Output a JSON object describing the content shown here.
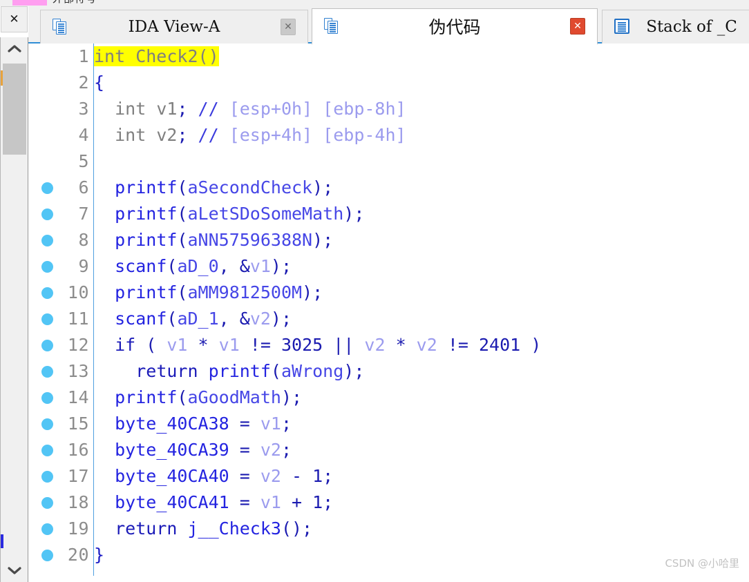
{
  "toolbar": {
    "swatch_color": "#ff9ef0",
    "partial_text": "外部符号"
  },
  "left_rail": {
    "close_label": "✕",
    "scroll_up_glyph": "⌃",
    "scroll_down_glyph": "⌄"
  },
  "tabs": [
    {
      "label": "IDA View-A",
      "icon": "document-pair-icon",
      "close_label": "✕",
      "active": false
    },
    {
      "label": "伪代码",
      "icon": "document-pair-icon",
      "close_label": "✕",
      "active": true
    },
    {
      "label": "Stack of _C",
      "icon": "stack-window-icon",
      "close_label": "",
      "active": false
    }
  ],
  "code": {
    "function_name": "Check2",
    "highlight_color": "#ffff00",
    "lines": [
      {
        "n": "1",
        "bp": false,
        "highlight": true,
        "tokens": [
          {
            "t": "int Check2()",
            "c": "t-hl"
          }
        ]
      },
      {
        "n": "2",
        "bp": false,
        "highlight": false,
        "tokens": [
          {
            "t": "{",
            "c": "t-brace"
          }
        ]
      },
      {
        "n": "3",
        "bp": false,
        "highlight": false,
        "tokens": [
          {
            "t": "  ",
            "c": "t-plain"
          },
          {
            "t": "int",
            "c": "t-kw"
          },
          {
            "t": " v1",
            "c": "t-kw"
          },
          {
            "t": ";",
            "c": "t-op"
          },
          {
            "t": " ",
            "c": "t-plain"
          },
          {
            "t": "//",
            "c": "t-cmt"
          },
          {
            "t": " [esp+0h] [ebp-8h]",
            "c": "t-cmt2"
          }
        ]
      },
      {
        "n": "4",
        "bp": false,
        "highlight": false,
        "tokens": [
          {
            "t": "  ",
            "c": "t-plain"
          },
          {
            "t": "int",
            "c": "t-kw"
          },
          {
            "t": " v2",
            "c": "t-kw"
          },
          {
            "t": ";",
            "c": "t-op"
          },
          {
            "t": " ",
            "c": "t-plain"
          },
          {
            "t": "//",
            "c": "t-cmt"
          },
          {
            "t": " [esp+4h] [ebp-4h]",
            "c": "t-cmt2"
          }
        ]
      },
      {
        "n": "5",
        "bp": false,
        "highlight": false,
        "tokens": []
      },
      {
        "n": "6",
        "bp": true,
        "highlight": false,
        "tokens": [
          {
            "t": "  ",
            "c": "t-plain"
          },
          {
            "t": "printf",
            "c": "t-fn"
          },
          {
            "t": "(",
            "c": "t-op"
          },
          {
            "t": "aSecondCheck",
            "c": "t-arg"
          },
          {
            "t": ");",
            "c": "t-op"
          }
        ]
      },
      {
        "n": "7",
        "bp": true,
        "highlight": false,
        "tokens": [
          {
            "t": "  ",
            "c": "t-plain"
          },
          {
            "t": "printf",
            "c": "t-fn"
          },
          {
            "t": "(",
            "c": "t-op"
          },
          {
            "t": "aLetSDoSomeMath",
            "c": "t-arg"
          },
          {
            "t": ");",
            "c": "t-op"
          }
        ]
      },
      {
        "n": "8",
        "bp": true,
        "highlight": false,
        "tokens": [
          {
            "t": "  ",
            "c": "t-plain"
          },
          {
            "t": "printf",
            "c": "t-fn"
          },
          {
            "t": "(",
            "c": "t-op"
          },
          {
            "t": "aNN57596388N",
            "c": "t-arg"
          },
          {
            "t": ");",
            "c": "t-op"
          }
        ]
      },
      {
        "n": "9",
        "bp": true,
        "highlight": false,
        "tokens": [
          {
            "t": "  ",
            "c": "t-plain"
          },
          {
            "t": "scanf",
            "c": "t-fn"
          },
          {
            "t": "(",
            "c": "t-op"
          },
          {
            "t": "aD_0",
            "c": "t-arg"
          },
          {
            "t": ", &",
            "c": "t-op"
          },
          {
            "t": "v1",
            "c": "t-var"
          },
          {
            "t": ");",
            "c": "t-op"
          }
        ]
      },
      {
        "n": "10",
        "bp": true,
        "highlight": false,
        "tokens": [
          {
            "t": "  ",
            "c": "t-plain"
          },
          {
            "t": "printf",
            "c": "t-fn"
          },
          {
            "t": "(",
            "c": "t-op"
          },
          {
            "t": "aMM9812500M",
            "c": "t-arg"
          },
          {
            "t": ");",
            "c": "t-op"
          }
        ]
      },
      {
        "n": "11",
        "bp": true,
        "highlight": false,
        "tokens": [
          {
            "t": "  ",
            "c": "t-plain"
          },
          {
            "t": "scanf",
            "c": "t-fn"
          },
          {
            "t": "(",
            "c": "t-op"
          },
          {
            "t": "aD_1",
            "c": "t-arg"
          },
          {
            "t": ", &",
            "c": "t-op"
          },
          {
            "t": "v2",
            "c": "t-var"
          },
          {
            "t": ");",
            "c": "t-op"
          }
        ]
      },
      {
        "n": "12",
        "bp": true,
        "highlight": false,
        "tokens": [
          {
            "t": "  ",
            "c": "t-plain"
          },
          {
            "t": "if",
            "c": "t-ctrl"
          },
          {
            "t": " ( ",
            "c": "t-op"
          },
          {
            "t": "v1",
            "c": "t-var"
          },
          {
            "t": " * ",
            "c": "t-op"
          },
          {
            "t": "v1",
            "c": "t-var"
          },
          {
            "t": " != ",
            "c": "t-op"
          },
          {
            "t": "3025",
            "c": "t-num"
          },
          {
            "t": " || ",
            "c": "t-op"
          },
          {
            "t": "v2",
            "c": "t-var"
          },
          {
            "t": " * ",
            "c": "t-op"
          },
          {
            "t": "v2",
            "c": "t-var"
          },
          {
            "t": " != ",
            "c": "t-op"
          },
          {
            "t": "2401",
            "c": "t-num"
          },
          {
            "t": " )",
            "c": "t-op"
          }
        ]
      },
      {
        "n": "13",
        "bp": true,
        "highlight": false,
        "tokens": [
          {
            "t": "    ",
            "c": "t-plain"
          },
          {
            "t": "return",
            "c": "t-ctrl"
          },
          {
            "t": " ",
            "c": "t-plain"
          },
          {
            "t": "printf",
            "c": "t-fn"
          },
          {
            "t": "(",
            "c": "t-op"
          },
          {
            "t": "aWrong",
            "c": "t-arg"
          },
          {
            "t": ");",
            "c": "t-op"
          }
        ]
      },
      {
        "n": "14",
        "bp": true,
        "highlight": false,
        "tokens": [
          {
            "t": "  ",
            "c": "t-plain"
          },
          {
            "t": "printf",
            "c": "t-fn"
          },
          {
            "t": "(",
            "c": "t-op"
          },
          {
            "t": "aGoodMath",
            "c": "t-arg"
          },
          {
            "t": ");",
            "c": "t-op"
          }
        ]
      },
      {
        "n": "15",
        "bp": true,
        "highlight": false,
        "tokens": [
          {
            "t": "  ",
            "c": "t-plain"
          },
          {
            "t": "byte_40CA38",
            "c": "t-glob"
          },
          {
            "t": " = ",
            "c": "t-op"
          },
          {
            "t": "v1",
            "c": "t-var"
          },
          {
            "t": ";",
            "c": "t-op"
          }
        ]
      },
      {
        "n": "16",
        "bp": true,
        "highlight": false,
        "tokens": [
          {
            "t": "  ",
            "c": "t-plain"
          },
          {
            "t": "byte_40CA39",
            "c": "t-glob"
          },
          {
            "t": " = ",
            "c": "t-op"
          },
          {
            "t": "v2",
            "c": "t-var"
          },
          {
            "t": ";",
            "c": "t-op"
          }
        ]
      },
      {
        "n": "17",
        "bp": true,
        "highlight": false,
        "tokens": [
          {
            "t": "  ",
            "c": "t-plain"
          },
          {
            "t": "byte_40CA40",
            "c": "t-glob"
          },
          {
            "t": " = ",
            "c": "t-op"
          },
          {
            "t": "v2",
            "c": "t-var"
          },
          {
            "t": " - ",
            "c": "t-op"
          },
          {
            "t": "1",
            "c": "t-num"
          },
          {
            "t": ";",
            "c": "t-op"
          }
        ]
      },
      {
        "n": "18",
        "bp": true,
        "highlight": false,
        "tokens": [
          {
            "t": "  ",
            "c": "t-plain"
          },
          {
            "t": "byte_40CA41",
            "c": "t-glob"
          },
          {
            "t": " = ",
            "c": "t-op"
          },
          {
            "t": "v1",
            "c": "t-var"
          },
          {
            "t": " + ",
            "c": "t-op"
          },
          {
            "t": "1",
            "c": "t-num"
          },
          {
            "t": ";",
            "c": "t-op"
          }
        ]
      },
      {
        "n": "19",
        "bp": true,
        "highlight": false,
        "tokens": [
          {
            "t": "  ",
            "c": "t-plain"
          },
          {
            "t": "return",
            "c": "t-ctrl"
          },
          {
            "t": " ",
            "c": "t-plain"
          },
          {
            "t": "j__Check3",
            "c": "t-fn"
          },
          {
            "t": "();",
            "c": "t-op"
          }
        ]
      },
      {
        "n": "20",
        "bp": true,
        "highlight": false,
        "tokens": [
          {
            "t": "}",
            "c": "t-brace"
          }
        ]
      }
    ]
  },
  "watermark": "CSDN @小哈里"
}
